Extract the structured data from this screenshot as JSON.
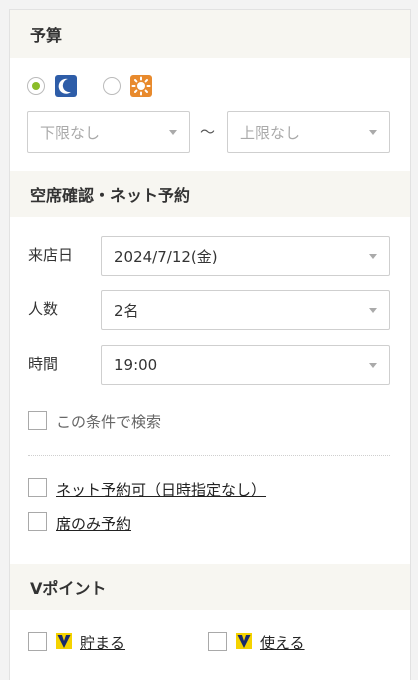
{
  "budget": {
    "title": "予算",
    "time_options": [
      {
        "id": "dinner",
        "icon": "moon-icon",
        "selected": true,
        "color": "#2e5da8"
      },
      {
        "id": "lunch",
        "icon": "sun-icon",
        "selected": false,
        "color": "#e88a2d"
      }
    ],
    "min_placeholder": "下限なし",
    "max_placeholder": "上限なし",
    "range_separator": "～"
  },
  "availability": {
    "title": "空席確認・ネット予約",
    "date_label": "来店日",
    "date_value": "2024/7/12(金)",
    "people_label": "人数",
    "people_value": "2名",
    "time_label": "時間",
    "time_value": "19:00",
    "search_condition_label": "この条件で検索",
    "net_reservation_label": "ネット予約可（日時指定なし）",
    "seat_only_label": "席のみ予約"
  },
  "vpoint": {
    "title": "Vポイント",
    "earn_label": "貯まる",
    "use_label": "使える",
    "brand_colors": {
      "yellow": "#f5d300",
      "navy": "#1a2a6c"
    }
  }
}
